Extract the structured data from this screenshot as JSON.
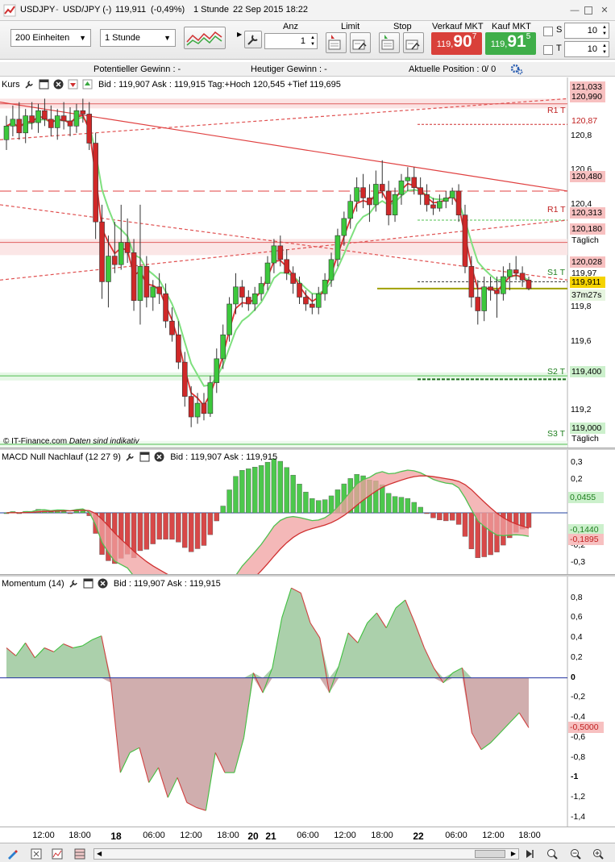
{
  "window": {
    "symbol": "USDJPY",
    "pair": "USD/JPY (-)",
    "price": "119,911",
    "change": "(-0,49%)",
    "timeframe": "1 Stunde",
    "datetime": "22 Sep 2015 18:22"
  },
  "toolbar": {
    "units": "200 Einheiten",
    "interval": "1 Stunde",
    "anz_label": "Anz",
    "anz_value": "1",
    "limit_label": "Limit",
    "stop_label": "Stop",
    "sell_label": "Verkauf MKT",
    "sell_small": "119,",
    "sell_big": "90",
    "sell_sup": "7",
    "buy_label": "Kauf MKT",
    "buy_small": "119,",
    "buy_big": "91",
    "buy_sup": "5",
    "s_label": "S",
    "s_value": "10",
    "t_label": "T",
    "t_value": "10",
    "sell_color": "#d9403a",
    "buy_color": "#3fae49"
  },
  "infobar": {
    "potential": "Potentieller Gewinn : -",
    "today": "Heutiger Gewinn : -",
    "position": "Aktuelle Position : 0",
    "position_extra": "/ 0"
  },
  "price_pane": {
    "name": "Kurs",
    "header": "Bid : 119,907 Ask : 119,915 Tag:+Hoch 120,545 +Tief 119,695",
    "credit": "© IT-Finance.com",
    "credit_note": "Daten sind indikativ",
    "axis_ticks": [
      "120,8",
      "120,6",
      "120,4",
      "119,8",
      "119,6",
      "119,2"
    ],
    "tags": [
      {
        "text": "121,033",
        "color": "#f7c0c0"
      },
      {
        "text": "120,990",
        "color": "#f7c0c0"
      },
      {
        "text": "R1 T",
        "color": ""
      },
      {
        "text": "120,87",
        "color": ""
      },
      {
        "text": "120,480",
        "color": "#f7c0c0"
      },
      {
        "text": "R1 T",
        "color": ""
      },
      {
        "text": "120,313",
        "color": "#f7c0c0"
      },
      {
        "text": "120,180",
        "color": "#f7c0c0"
      },
      {
        "text": "Täglich",
        "color": ""
      },
      {
        "text": "120,028",
        "color": "#f7c0c0"
      },
      {
        "text": "S1 T",
        "color": ""
      },
      {
        "text": "119,97",
        "color": ""
      },
      {
        "text": "119,911",
        "color": "#f5d300"
      },
      {
        "text": "37m27s",
        "color": "#e6f5e0"
      },
      {
        "text": "S2 T",
        "color": ""
      },
      {
        "text": "119,400",
        "color": "#ccf0cc"
      },
      {
        "text": "S3 T",
        "color": ""
      },
      {
        "text": "119,000",
        "color": "#ccf0cc"
      },
      {
        "text": "Täglich",
        "color": ""
      }
    ]
  },
  "macd_pane": {
    "name": "MACD Null Nachlauf (12 27 9)",
    "header": "Bid : 119,907 Ask : 119,915",
    "axis_ticks": [
      "0,3",
      "0,2",
      "0,1",
      "-0,1",
      "-0,2",
      "-0,3"
    ],
    "tags": [
      {
        "text": "0,0455",
        "color": "#ccf0cc"
      },
      {
        "text": "-0,1440",
        "color": "#ccf0cc"
      },
      {
        "text": "-0,1895",
        "color": "#f7c0c0"
      }
    ]
  },
  "momentum_pane": {
    "name": "Momentum (14)",
    "header": "Bid : 119,907 Ask : 119,915",
    "axis_ticks": [
      "0,8",
      "0,6",
      "0,4",
      "0,2",
      "0",
      "-0,2",
      "-0,4",
      "-0,6",
      "-0,8",
      "-1",
      "-1,2",
      "-1,4"
    ],
    "tag": {
      "text": "-0,5000",
      "color": "#f7c0c0"
    }
  },
  "time_axis": {
    "labels": [
      {
        "text": "12:00",
        "bold": false
      },
      {
        "text": "18:00",
        "bold": false
      },
      {
        "text": "18",
        "bold": true
      },
      {
        "text": "06:00",
        "bold": false
      },
      {
        "text": "12:00",
        "bold": false
      },
      {
        "text": "18:00",
        "bold": false
      },
      {
        "text": "20",
        "bold": true
      },
      {
        "text": "21",
        "bold": true
      },
      {
        "text": "06:00",
        "bold": false
      },
      {
        "text": "12:00",
        "bold": false
      },
      {
        "text": "18:00",
        "bold": false
      },
      {
        "text": "22",
        "bold": true
      },
      {
        "text": "06:00",
        "bold": false
      },
      {
        "text": "12:00",
        "bold": false
      },
      {
        "text": "18:00",
        "bold": false
      }
    ]
  },
  "chart_data": {
    "type": "line",
    "title": "",
    "xlabel": "",
    "ylabel": "",
    "ylim": [
      119.0,
      121.05
    ],
    "candles": [
      {
        "o": 120.78,
        "h": 120.92,
        "l": 120.72,
        "c": 120.86
      },
      {
        "o": 120.86,
        "h": 120.98,
        "l": 120.8,
        "c": 120.9
      },
      {
        "o": 120.9,
        "h": 121.0,
        "l": 120.78,
        "c": 120.82
      },
      {
        "o": 120.82,
        "h": 120.96,
        "l": 120.76,
        "c": 120.92
      },
      {
        "o": 120.92,
        "h": 121.0,
        "l": 120.84,
        "c": 120.88
      },
      {
        "o": 120.88,
        "h": 120.99,
        "l": 120.82,
        "c": 120.95
      },
      {
        "o": 120.95,
        "h": 121.02,
        "l": 120.86,
        "c": 120.9
      },
      {
        "o": 120.9,
        "h": 120.98,
        "l": 120.8,
        "c": 120.85
      },
      {
        "o": 120.85,
        "h": 120.96,
        "l": 120.78,
        "c": 120.92
      },
      {
        "o": 120.92,
        "h": 121.0,
        "l": 120.84,
        "c": 120.89
      },
      {
        "o": 120.89,
        "h": 120.97,
        "l": 120.8,
        "c": 120.86
      },
      {
        "o": 120.86,
        "h": 120.99,
        "l": 120.82,
        "c": 120.95
      },
      {
        "o": 120.95,
        "h": 121.02,
        "l": 120.88,
        "c": 120.93
      },
      {
        "o": 120.93,
        "h": 121.0,
        "l": 120.72,
        "c": 120.76
      },
      {
        "o": 120.76,
        "h": 120.82,
        "l": 120.2,
        "c": 120.3
      },
      {
        "o": 120.3,
        "h": 120.4,
        "l": 119.85,
        "c": 119.95
      },
      {
        "o": 119.95,
        "h": 120.22,
        "l": 119.8,
        "c": 120.1
      },
      {
        "o": 120.1,
        "h": 120.3,
        "l": 120.0,
        "c": 120.05
      },
      {
        "o": 120.05,
        "h": 120.4,
        "l": 120.02,
        "c": 120.18
      },
      {
        "o": 120.18,
        "h": 120.32,
        "l": 120.06,
        "c": 120.12
      },
      {
        "o": 120.12,
        "h": 120.2,
        "l": 119.78,
        "c": 119.84
      },
      {
        "o": 119.84,
        "h": 120.4,
        "l": 119.7,
        "c": 120.04
      },
      {
        "o": 120.04,
        "h": 120.1,
        "l": 119.8,
        "c": 119.86
      },
      {
        "o": 119.86,
        "h": 119.96,
        "l": 119.78,
        "c": 119.92
      },
      {
        "o": 119.92,
        "h": 120.0,
        "l": 119.82,
        "c": 119.88
      },
      {
        "o": 119.88,
        "h": 119.94,
        "l": 119.68,
        "c": 119.72
      },
      {
        "o": 119.72,
        "h": 119.8,
        "l": 119.6,
        "c": 119.64
      },
      {
        "o": 119.64,
        "h": 119.72,
        "l": 119.44,
        "c": 119.48
      },
      {
        "o": 119.48,
        "h": 119.54,
        "l": 119.22,
        "c": 119.28
      },
      {
        "o": 119.28,
        "h": 119.34,
        "l": 119.1,
        "c": 119.16
      },
      {
        "o": 119.16,
        "h": 119.3,
        "l": 119.12,
        "c": 119.24
      },
      {
        "o": 119.24,
        "h": 119.3,
        "l": 119.14,
        "c": 119.18
      },
      {
        "o": 119.18,
        "h": 119.4,
        "l": 119.16,
        "c": 119.36
      },
      {
        "o": 119.36,
        "h": 119.56,
        "l": 119.3,
        "c": 119.5
      },
      {
        "o": 119.5,
        "h": 119.7,
        "l": 119.44,
        "c": 119.64
      },
      {
        "o": 119.64,
        "h": 119.86,
        "l": 119.6,
        "c": 119.82
      },
      {
        "o": 119.82,
        "h": 120.0,
        "l": 119.76,
        "c": 119.92
      },
      {
        "o": 119.92,
        "h": 119.96,
        "l": 119.8,
        "c": 119.86
      },
      {
        "o": 119.86,
        "h": 119.9,
        "l": 119.78,
        "c": 119.82
      },
      {
        "o": 119.82,
        "h": 119.92,
        "l": 119.78,
        "c": 119.88
      },
      {
        "o": 119.88,
        "h": 119.98,
        "l": 119.84,
        "c": 119.94
      },
      {
        "o": 119.94,
        "h": 120.1,
        "l": 119.9,
        "c": 120.06
      },
      {
        "o": 120.06,
        "h": 120.2,
        "l": 120.0,
        "c": 120.16
      },
      {
        "o": 120.16,
        "h": 120.22,
        "l": 120.04,
        "c": 120.08
      },
      {
        "o": 120.08,
        "h": 120.14,
        "l": 119.96,
        "c": 120.0
      },
      {
        "o": 120.0,
        "h": 120.04,
        "l": 119.88,
        "c": 119.94
      },
      {
        "o": 119.94,
        "h": 119.98,
        "l": 119.82,
        "c": 119.86
      },
      {
        "o": 119.86,
        "h": 119.9,
        "l": 119.78,
        "c": 119.82
      },
      {
        "o": 119.82,
        "h": 119.88,
        "l": 119.76,
        "c": 119.8
      },
      {
        "o": 119.8,
        "h": 119.92,
        "l": 119.76,
        "c": 119.88
      },
      {
        "o": 119.88,
        "h": 120.0,
        "l": 119.84,
        "c": 119.96
      },
      {
        "o": 119.96,
        "h": 120.12,
        "l": 119.92,
        "c": 120.08
      },
      {
        "o": 120.08,
        "h": 120.26,
        "l": 120.04,
        "c": 120.22
      },
      {
        "o": 120.22,
        "h": 120.36,
        "l": 120.16,
        "c": 120.32
      },
      {
        "o": 120.32,
        "h": 120.46,
        "l": 120.26,
        "c": 120.42
      },
      {
        "o": 120.42,
        "h": 120.56,
        "l": 120.36,
        "c": 120.5
      },
      {
        "o": 120.5,
        "h": 120.58,
        "l": 120.38,
        "c": 120.44
      },
      {
        "o": 120.44,
        "h": 120.52,
        "l": 120.3,
        "c": 120.4
      },
      {
        "o": 120.4,
        "h": 120.6,
        "l": 120.36,
        "c": 120.52
      },
      {
        "o": 120.52,
        "h": 120.66,
        "l": 120.44,
        "c": 120.48
      },
      {
        "o": 120.48,
        "h": 120.54,
        "l": 120.28,
        "c": 120.34
      },
      {
        "o": 120.34,
        "h": 120.5,
        "l": 120.3,
        "c": 120.46
      },
      {
        "o": 120.46,
        "h": 120.58,
        "l": 120.4,
        "c": 120.54
      },
      {
        "o": 120.54,
        "h": 120.62,
        "l": 120.48,
        "c": 120.56
      },
      {
        "o": 120.56,
        "h": 120.62,
        "l": 120.46,
        "c": 120.5
      },
      {
        "o": 120.5,
        "h": 120.56,
        "l": 120.4,
        "c": 120.46
      },
      {
        "o": 120.46,
        "h": 120.52,
        "l": 120.36,
        "c": 120.4
      },
      {
        "o": 120.4,
        "h": 120.44,
        "l": 120.34,
        "c": 120.38
      },
      {
        "o": 120.38,
        "h": 120.46,
        "l": 120.36,
        "c": 120.42
      },
      {
        "o": 120.42,
        "h": 120.48,
        "l": 120.38,
        "c": 120.44
      },
      {
        "o": 120.44,
        "h": 120.5,
        "l": 120.4,
        "c": 120.48
      },
      {
        "o": 120.48,
        "h": 120.52,
        "l": 120.3,
        "c": 120.34
      },
      {
        "o": 120.34,
        "h": 120.4,
        "l": 120.0,
        "c": 120.04
      },
      {
        "o": 120.04,
        "h": 120.1,
        "l": 119.8,
        "c": 119.86
      },
      {
        "o": 119.86,
        "h": 119.96,
        "l": 119.7,
        "c": 119.78
      },
      {
        "o": 119.78,
        "h": 119.98,
        "l": 119.72,
        "c": 119.92
      },
      {
        "o": 119.92,
        "h": 119.98,
        "l": 119.84,
        "c": 119.9
      },
      {
        "o": 119.9,
        "h": 119.98,
        "l": 119.74,
        "c": 119.88
      },
      {
        "o": 119.88,
        "h": 120.04,
        "l": 119.84,
        "c": 119.98
      },
      {
        "o": 119.98,
        "h": 120.06,
        "l": 119.9,
        "c": 120.02
      },
      {
        "o": 120.02,
        "h": 120.1,
        "l": 119.96,
        "c": 120.0
      },
      {
        "o": 120.0,
        "h": 120.04,
        "l": 119.92,
        "c": 119.96
      },
      {
        "o": 119.96,
        "h": 119.98,
        "l": 119.9,
        "c": 119.91
      }
    ],
    "macd_ylim": [
      -0.34,
      0.34
    ],
    "momentum_ylim": [
      -1.45,
      0.95
    ],
    "momentum": [
      0.3,
      0.22,
      0.35,
      0.2,
      0.3,
      0.26,
      0.34,
      0.3,
      0.32,
      0.38,
      0.42,
      -0.05,
      -0.95,
      -0.75,
      -0.7,
      -1.05,
      -0.9,
      -1.2,
      -1.0,
      -1.25,
      -1.3,
      -1.33,
      -0.75,
      -0.95,
      -0.95,
      -0.6,
      0.05,
      -0.15,
      0.1,
      0.6,
      0.9,
      0.85,
      0.55,
      0.4,
      -0.15,
      0.12,
      0.45,
      0.35,
      0.55,
      0.65,
      0.5,
      0.7,
      0.78,
      0.55,
      0.3,
      0.1,
      -0.05,
      0.05,
      0.1,
      -0.55,
      -0.72,
      -0.65,
      -0.55,
      -0.45,
      -0.35,
      -0.5
    ]
  }
}
